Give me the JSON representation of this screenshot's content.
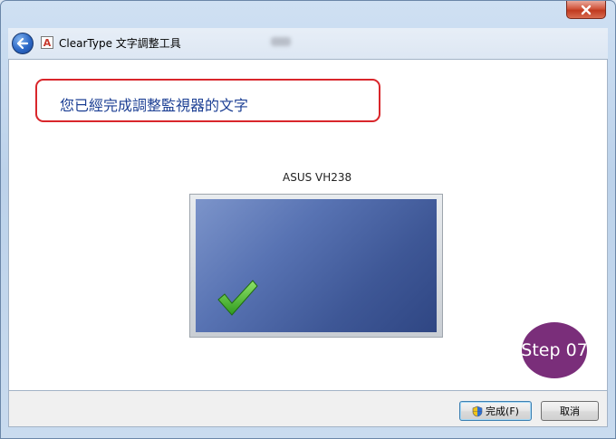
{
  "window": {
    "title_blurred": "",
    "accent": "#1c3f94"
  },
  "header": {
    "app_title": "ClearType 文字調整工具",
    "icon": "back-arrow-icon"
  },
  "content": {
    "heading": "您已經完成調整監視器的文字",
    "monitor_name": "ASUS VH238",
    "step_badge": "Step 07",
    "highlight_color": "#d9262b",
    "badge_color": "#7a2e7a"
  },
  "footer": {
    "finish_label": "完成(F)",
    "cancel_label": "取消"
  },
  "icons": {
    "back": "back-arrow-icon",
    "app": "cleartype-icon",
    "close": "close-icon",
    "check": "checkmark-icon",
    "shield": "uac-shield-icon"
  }
}
